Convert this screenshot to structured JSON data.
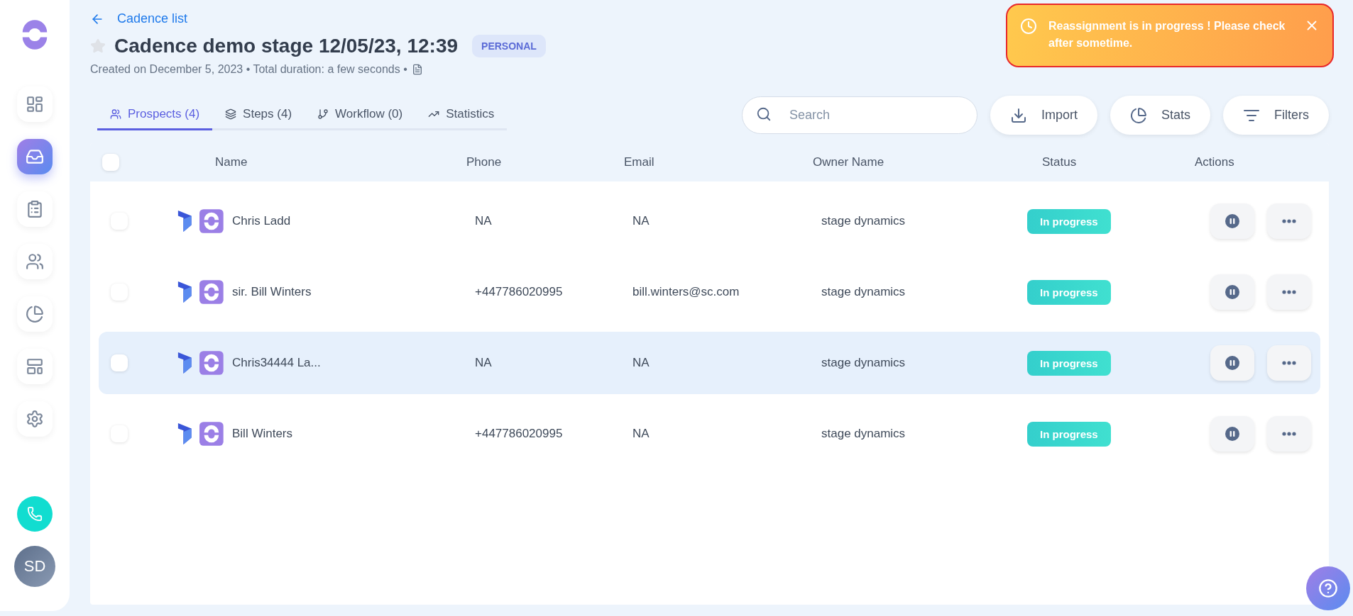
{
  "sidebar": {
    "items": [
      {
        "selected": false
      },
      {
        "selected": true
      },
      {
        "selected": false
      },
      {
        "selected": false
      },
      {
        "selected": false
      },
      {
        "selected": false
      },
      {
        "selected": false
      }
    ],
    "avatar": "SD"
  },
  "back_link": "Cadence list",
  "title": "Cadence demo stage 12/05/23, 12:39",
  "starred": false,
  "badge": "PERSONAL",
  "subtitle": "Created on December 5, 2023 • Total duration: a few seconds •",
  "tabs": [
    {
      "label": "Prospects (4)",
      "selected": true
    },
    {
      "label": "Steps (4)",
      "selected": false
    },
    {
      "label": "Workflow (0)",
      "selected": false
    },
    {
      "label": "Statistics",
      "selected": false
    }
  ],
  "search": {
    "placeholder": "Search"
  },
  "toolbar": [
    "Import",
    "Stats",
    "Filters"
  ],
  "toast": {
    "message": "Reassignment is in progress ! Please check after sometime."
  },
  "table": {
    "select_all_checked": false,
    "columns": [
      "Name",
      "Phone",
      "Email",
      "Owner Name",
      "Status",
      "Actions"
    ],
    "rows": [
      {
        "checked": false,
        "highlighted": false,
        "name": "Chris Ladd",
        "phone": "NA",
        "email": "NA",
        "owner": "stage dynamics",
        "status": "In progress"
      },
      {
        "checked": false,
        "highlighted": false,
        "name": "sir. Bill Winters",
        "phone": "+447786020995",
        "email": "bill.winters@sc.com",
        "owner": "stage dynamics",
        "status": "In progress"
      },
      {
        "checked": false,
        "highlighted": true,
        "name": "Chris34444 La...",
        "phone": "NA",
        "email": "NA",
        "owner": "stage dynamics",
        "status": "In progress"
      },
      {
        "checked": false,
        "highlighted": false,
        "name": "Bill Winters",
        "phone": "+447786020995",
        "email": "NA",
        "owner": "stage dynamics",
        "status": "In progress"
      }
    ]
  }
}
